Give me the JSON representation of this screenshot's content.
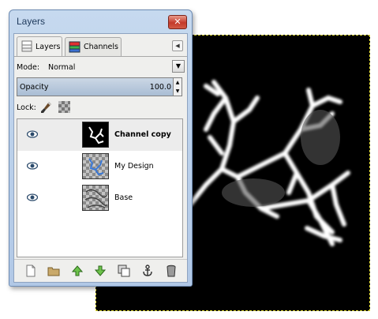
{
  "dialog": {
    "title": "Layers",
    "close_label": "✕"
  },
  "tabs": [
    {
      "label": "Layers",
      "icon": "layers-icon",
      "active": true
    },
    {
      "label": "Channels",
      "icon": "channels-icon",
      "active": false
    }
  ],
  "mode": {
    "label": "Mode:",
    "value": "Normal"
  },
  "opacity": {
    "label": "Opacity",
    "value": "100.0"
  },
  "lock": {
    "label": "Lock:"
  },
  "layers": [
    {
      "name": "Channel copy",
      "visible": true,
      "selected": true
    },
    {
      "name": "My Design",
      "visible": true,
      "selected": false
    },
    {
      "name": "Base",
      "visible": true,
      "selected": false
    }
  ],
  "toolbar": [
    "new-layer-icon",
    "new-layer-group-icon",
    "raise-layer-icon",
    "lower-layer-icon",
    "duplicate-layer-icon",
    "anchor-layer-icon",
    "delete-layer-icon"
  ],
  "colors": {
    "titlebar": "#c6d9ef",
    "selection_marquee": "#e8e23a",
    "canvas_background": "#000000"
  }
}
